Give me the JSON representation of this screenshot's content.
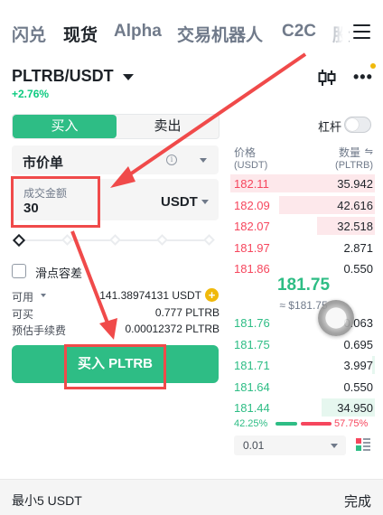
{
  "tabs": [
    "闪兑",
    "现货",
    "Alpha",
    "交易机器人",
    "C2C",
    "股"
  ],
  "active_tab": "现货",
  "pair": "PLTRB/USDT",
  "change": "+2.76%",
  "toggle": {
    "buy": "买入",
    "sell": "卖出"
  },
  "leverage": "杠杆",
  "order_type": "市价单",
  "amount": {
    "label": "成交金额",
    "value": "30",
    "unit": "USDT"
  },
  "slippage": "滑点容差",
  "info": {
    "available_label": "可用",
    "available_value": "141.38974131 USDT",
    "buyable_label": "可买",
    "buyable_value": "0.777 PLTRB",
    "fee_label": "预估手续费",
    "fee_value": "0.00012372 PLTRB"
  },
  "buy_button": "买入 PLTRB",
  "orderbook": {
    "price_header": "价格",
    "price_unit": "(USDT)",
    "qty_header": "数量",
    "qty_unit": "(PLTRB)",
    "swap_icon": "⇋",
    "asks": [
      {
        "price": "182.11",
        "qty": "35.942",
        "depth": 1.0
      },
      {
        "price": "182.09",
        "qty": "42.616",
        "depth": 0.66
      },
      {
        "price": "182.07",
        "qty": "32.518",
        "depth": 0.4
      },
      {
        "price": "181.97",
        "qty": "2.871",
        "depth": 0
      },
      {
        "price": "181.86",
        "qty": "0.550",
        "depth": 0
      }
    ],
    "mid_price": "181.75",
    "mid_ref": "≈ $181.75",
    "bids": [
      {
        "price": "181.76",
        "qty": "0.063",
        "depth": 0
      },
      {
        "price": "181.75",
        "qty": "0.695",
        "depth": 0
      },
      {
        "price": "181.71",
        "qty": "3.997",
        "depth": 0.02
      },
      {
        "price": "181.64",
        "qty": "0.550",
        "depth": 0
      },
      {
        "price": "181.44",
        "qty": "34.950",
        "depth": 0.37
      }
    ],
    "buy_ratio": "42.25%",
    "sell_ratio": "57.75%",
    "precision": "0.01"
  },
  "bottom": {
    "left": "最小5 USDT",
    "right": "完成"
  },
  "colors": {
    "green": "#2ebd85",
    "red": "#f6465d",
    "annotation": "#f04a4a"
  }
}
